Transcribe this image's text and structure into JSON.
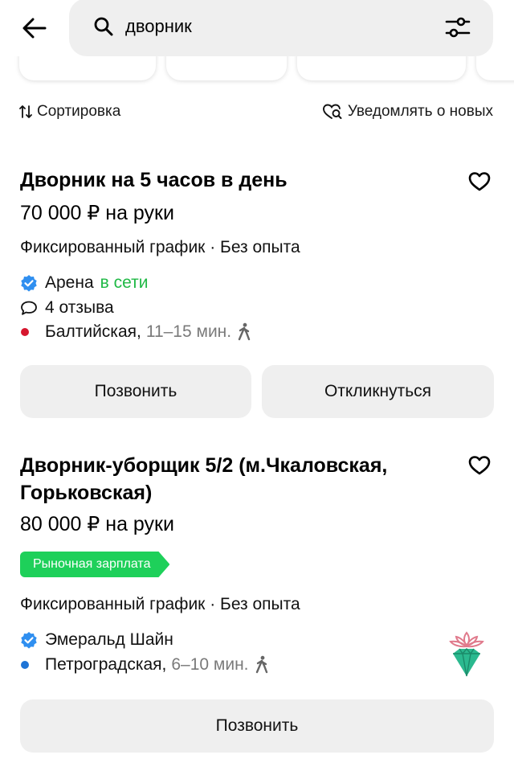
{
  "search": {
    "query": "дворник"
  },
  "controls": {
    "sort_label": "Сортировка",
    "notify_label": "Уведомлять о новых"
  },
  "vacancies": [
    {
      "title": "Дворник на 5 часов в день",
      "salary": "70 000 ₽ на руки",
      "schedule": "Фиксированный график · Без опыта",
      "employer": "Арена",
      "employer_status": "в сети",
      "reviews": "4 отзыва",
      "metro_station": "Балтийская,",
      "metro_color": "#d6162e",
      "travel_time": "11–15 мин.",
      "buttons": {
        "call": "Позвонить",
        "respond": "Откликнуться"
      }
    },
    {
      "title": "Дворник-уборщик 5/2 (м.Чкаловская, Горьковская)",
      "salary": "80 000 ₽ на руки",
      "badge": "Рыночная зарплата",
      "schedule": "Фиксированный график · Без опыта",
      "employer": "Эмеральд Шайн",
      "metro_station": "Петроградская,",
      "metro_color": "#1e74d6",
      "travel_time": "6–10 мин.",
      "buttons": {
        "call": "Позвонить"
      }
    }
  ],
  "icons": {
    "back": "arrow-left-icon",
    "search": "search-icon",
    "filter": "sliders-icon",
    "sort": "sort-arrows-icon",
    "notify": "heart-search-icon",
    "favorite": "heart-outline-icon",
    "verified": "verified-badge-icon",
    "reviews": "speech-bubble-icon",
    "walk": "walking-person-icon"
  },
  "colors": {
    "accent_green": "#1ed05a",
    "online_green": "#20b946",
    "verified_blue": "#2f8ff0",
    "button_gray": "#efefef"
  }
}
